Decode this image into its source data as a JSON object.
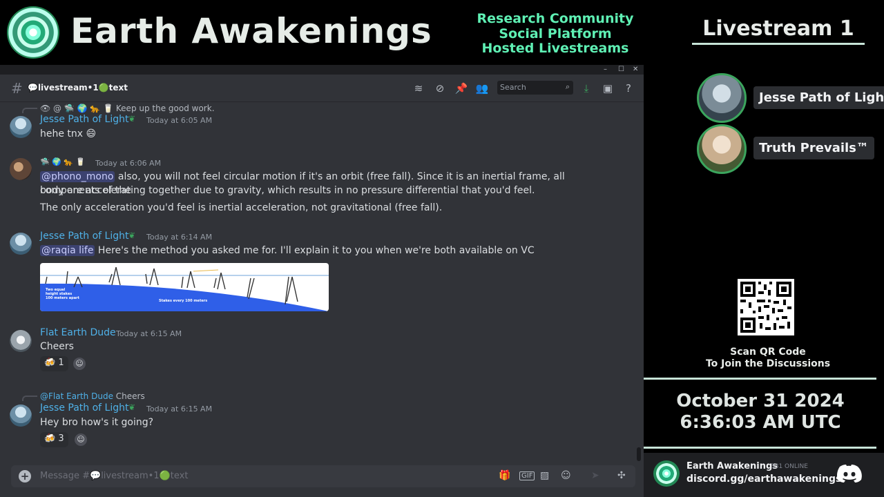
{
  "banner": {
    "brand": "Earth Awakenings",
    "taglines": [
      "Research Community",
      "Social Platform",
      "Hosted Livestreams"
    ]
  },
  "window": {
    "minimize": "–",
    "maximize": "☐",
    "close": "✕"
  },
  "channel": {
    "name": "💬livestream•1🟢text",
    "search_placeholder": "Search"
  },
  "messages": [
    {
      "reply": {
        "emoji": "👁 @ 🛸 🌍 🐆 🥛",
        "text": "Keep up the good work."
      },
      "author": "Jesse Path of Light",
      "time": "Today at 6:05 AM",
      "lines": [
        "hehe tnx 😄"
      ]
    },
    {
      "emoji_name": "🛸 🌍 🐆 🥛",
      "time": "Today at 6:06 AM",
      "mention": "@phono_mono",
      "lines": [
        "also, you will not feel circular motion if it's an orbit (free fall). Since it is an inertial frame, all components of the",
        "body are accelerating together due to gravity, which results in no pressure differential that you'd feel.",
        "The only acceleration you'd feel is inertial acceleration, not gravitational (free fall)."
      ]
    },
    {
      "author": "Jesse Path of Light",
      "time": "Today at 6:14 AM",
      "mention": "@raqia life",
      "lines": [
        "Here's the method you asked me for. I'll explain it to  you when we're both available on VC"
      ],
      "attachment": {
        "label_left": [
          "Two equal",
          "height stakes",
          "100 meters apart"
        ],
        "label_mid": "Stakes every 100 meters"
      }
    },
    {
      "author": "Flat Earth Dude",
      "time": "Today at 6:15 AM",
      "lines": [
        "Cheers"
      ],
      "reaction": {
        "emoji": "🍻",
        "count": "1"
      }
    },
    {
      "reply": {
        "mention": "@Flat Earth Dude",
        "text": "Cheers"
      },
      "author": "Jesse Path of Light",
      "time": "Today at 6:15 AM",
      "lines": [
        "Hey bro how's it going?"
      ],
      "reaction": {
        "emoji": "🍻",
        "count": "3"
      }
    }
  ],
  "composer": {
    "placeholder": "Message #💬livestream•1🟢text"
  },
  "sidebar": {
    "title": "Livestream 1",
    "participants": [
      {
        "name": "Jesse Path of Light"
      },
      {
        "name": "Truth Prevails™"
      }
    ],
    "qr_caption": [
      "Scan QR Code",
      "To Join the Discussions"
    ],
    "date": "October 31 2024",
    "time": "6:36:03 AM UTC",
    "server": {
      "name": "Earth Awakenings",
      "online": "331 ONLINE",
      "invite": "discord.gg/earthawakenings"
    }
  },
  "colors": {
    "accent_green": "#5ff0b4",
    "username_blue": "#4fb1e8",
    "discord_bg": "#313338",
    "mention_bg": "#3c4270"
  }
}
